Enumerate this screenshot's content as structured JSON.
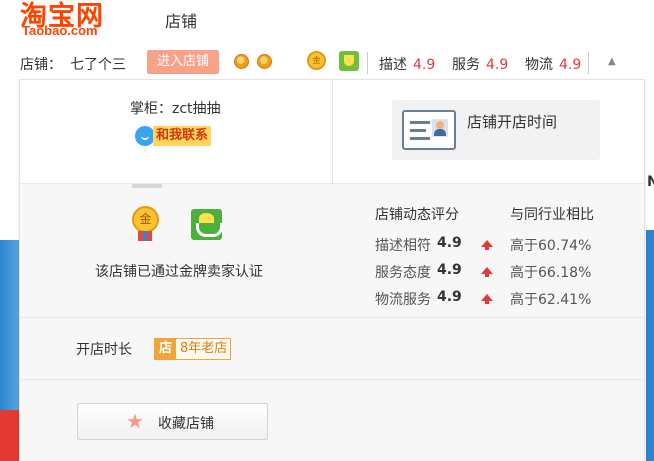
{
  "header": {
    "logo_main": "淘宝网",
    "logo_sub": "Taobao.com",
    "title": "店铺"
  },
  "shop_bar": {
    "shop_label": "店铺：",
    "shop_name": "七了个三",
    "enter_button": "进入店铺",
    "gold_icon_text": "金",
    "scores": [
      {
        "label": "描述",
        "value": "4.9"
      },
      {
        "label": "服务",
        "value": "4.9"
      },
      {
        "label": "物流",
        "value": "4.9"
      }
    ],
    "collapse_icon": "chevron-up-icon"
  },
  "panel": {
    "keeper_label": "掌柜：zct抽抽",
    "contact_label": "和我联系",
    "open_time_label": "店铺开店时间",
    "medal_text": "金",
    "certification_text": "该店铺已通过金牌卖家认证",
    "dynamic_rating_header": "店铺动态评分",
    "industry_compare_header": "与同行业相比",
    "ratings": [
      {
        "label": "描述相符",
        "score": "4.9",
        "compare": "高于60.74%"
      },
      {
        "label": "服务态度",
        "score": "4.9",
        "compare": "高于66.18%"
      },
      {
        "label": "物流服务",
        "score": "4.9",
        "compare": "高于62.41%"
      }
    ],
    "duration_label": "开店时长",
    "old_shop_icon": "店",
    "old_shop_label": "8年老店",
    "favorite_button": "收藏店铺"
  },
  "background": {
    "edge_letter": "N"
  },
  "colors": {
    "brand": "#ff4400",
    "enter_button_bg": "#f9a28a",
    "score_value": "#e4393c",
    "old_shop": "#f0a43a"
  }
}
